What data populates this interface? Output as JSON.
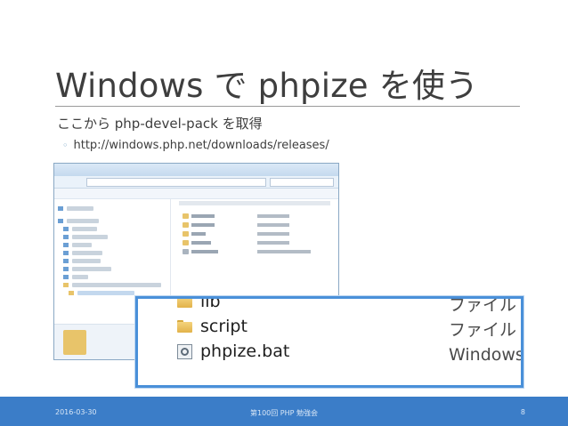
{
  "slide": {
    "title": "Windows で phpize を使う",
    "bullet_main": "ここから php-devel-pack を取得",
    "bullet_sub": "http://windows.php.net/downloads/releases/"
  },
  "zoom_files": [
    {
      "name": "lib",
      "type": "ファイル フ",
      "icon": "folder-icon"
    },
    {
      "name": "script",
      "type": "ファイル フ",
      "icon": "folder-icon"
    },
    {
      "name": "phpize.bat",
      "type": "Windows バ",
      "icon": "batch-file-icon"
    }
  ],
  "footer": {
    "date": "2016-03-30",
    "event": "第100回 PHP 勉強会",
    "page": "8"
  },
  "colors": {
    "footer_bg": "#3b7dc8",
    "zoom_border": "#4a90d9"
  }
}
